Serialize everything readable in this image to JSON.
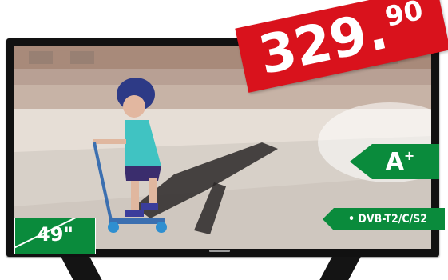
{
  "product": {
    "price_int": "329",
    "price_dot": ".",
    "price_dec": "90",
    "energy_class": "A",
    "energy_plus": "+",
    "tuner": "• DVB-T2/C/S2",
    "screen_size": "49\""
  },
  "colors": {
    "price_red": "#d9121c",
    "label_green": "#0a8b3c",
    "tv_black": "#111111"
  }
}
